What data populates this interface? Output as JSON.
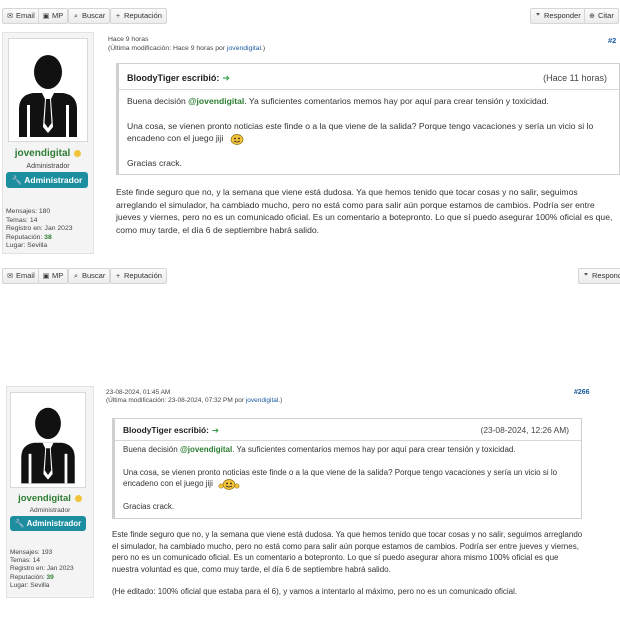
{
  "actions": {
    "email": "Email",
    "mp": "MP",
    "buscar": "Buscar",
    "reputacion": "Reputación",
    "responder": "Responder",
    "citar": "Citar"
  },
  "posts": [
    {
      "date": "Hace 9 horas",
      "modified_prefix": "(Última modificación: Hace 9 horas por ",
      "modified_user": "jovendigital",
      "modified_suffix": ".)",
      "post_number": "#2",
      "user": {
        "name": "jovendigital",
        "role": "Administrador",
        "badge": "Administrador",
        "stats": [
          {
            "label": "Mensajes:",
            "value": "180"
          },
          {
            "label": "Temas:",
            "value": "14"
          },
          {
            "label": "Registro en:",
            "value": "Jan 2023"
          },
          {
            "label": "Reputación:",
            "value": "38"
          },
          {
            "label": "Lugar:",
            "value": "Sevilla"
          }
        ]
      },
      "quote": {
        "author": "BloodyTiger escribió:",
        "date": "(Hace 11 horas)",
        "p1_before": "Buena decisión ",
        "mention": "@jovendigital",
        "p1_after": ". Ya suficientes comentarios memos hay por aquí para crear tensión y toxicidad.",
        "p2": "Una cosa, se vienen pronto noticias este finde o a la que viene de la salida? Porque tengo vacaciones y sería un vicio si lo encadeno con el juego jiji",
        "p3": "Gracias crack."
      },
      "body": "Este finde seguro que no, y la semana que viene está dudosa. Ya que hemos tenido que tocar cosas y no salir, seguimos arreglando el simulador, ha cambiado mucho, pero no está como para salir aún porque estamos de cambios. Podría ser entre jueves y viernes, pero no es un comunicado oficial. Es un comentario a botepronto. Lo que sí puedo asegurar 100% oficial es que, como muy tarde, el día 6 de septiembre habrá salido."
    },
    {
      "date": "23-08-2024, 01:45 AM",
      "modified_prefix": "(Última modificación: 23-08-2024, 07:32 PM por ",
      "modified_user": "jovendigital",
      "modified_suffix": ".)",
      "post_number": "#266",
      "user": {
        "name": "jovendigital",
        "role": "Administrador",
        "badge": "Administrador",
        "stats": [
          {
            "label": "Mensajes:",
            "value": "193"
          },
          {
            "label": "Temas:",
            "value": "14"
          },
          {
            "label": "Registro en:",
            "value": "Jan 2023"
          },
          {
            "label": "Reputación:",
            "value": "39"
          },
          {
            "label": "Lugar:",
            "value": "Sevilla"
          }
        ]
      },
      "quote": {
        "author": "BloodyTiger escribió:",
        "date": "(23-08-2024, 12:26 AM)",
        "p1_before": "Buena decisión ",
        "mention": "@jovendigital",
        "p1_after": ". Ya suficientes comentarios memos hay por aquí para crear tensión y toxicidad.",
        "p2": "Una cosa, se vienen pronto noticias este finde o a la que viene de la salida? Porque tengo vacaciones y sería un vicio si lo encadeno con el juego jiji",
        "p3": "Gracias crack."
      },
      "body": "Este finde seguro que no, y la semana que viene está dudosa. Ya que hemos tenido que tocar cosas y no salir, seguimos arreglando el simulador, ha cambiado mucho, pero no está como para salir aún porque estamos de cambios. Podría ser entre jueves y viernes, pero no es un comunicado oficial. Es un comentario a botepronto. Lo que sí puedo asegurar ahora mismo 100% oficial es que nuestra voluntad es que, como muy tarde, el día 6 de septiembre habrá salido.",
      "body2": "(He editado: 100% oficial que estaba para el 6), y vamos a intentarlo al máximo, pero no es un comunicado oficial."
    }
  ]
}
